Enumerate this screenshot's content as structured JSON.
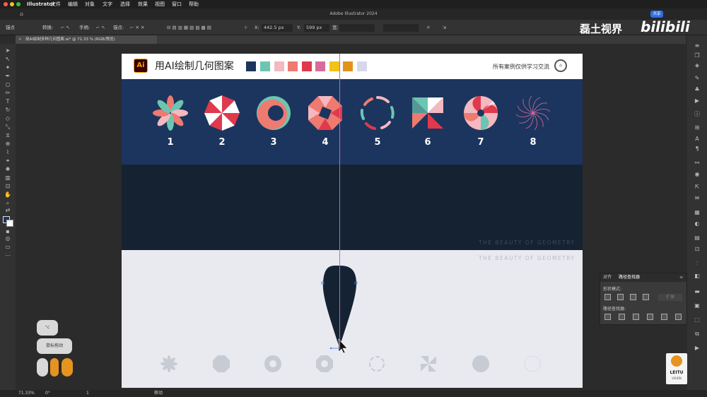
{
  "menubar": {
    "app": "Illustrator",
    "items": [
      "文件",
      "编辑",
      "对象",
      "文字",
      "选择",
      "效果",
      "视图",
      "窗口",
      "帮助"
    ]
  },
  "titlebar": {
    "title": "Adobe Illustrator 2024",
    "share": "共享"
  },
  "controlbar": {
    "anchor_label": "锚点",
    "convert_label": "转换:",
    "handle_label": "手柄:",
    "anchor2_label": "锚点:",
    "x_label": "X:",
    "x_value": "442.5 px",
    "y_label": "Y:",
    "y_value": "599 px",
    "w_label": "宽:"
  },
  "tab": {
    "label": "用AI绘制多种几何图案.ai* @ 71.33 % (RGB/预览)"
  },
  "artboard": {
    "title": "用AI绘制几何图案",
    "logo": "Ai",
    "note": "所有案例仅供学习交流",
    "swatches": [
      "#1c355e",
      "#6cc5b0",
      "#f4b8c0",
      "#ee7a70",
      "#e0394c",
      "#d96b9c",
      "#f0c21b",
      "#e3931a",
      "#d8d8ec"
    ],
    "numbers": [
      "1",
      "2",
      "3",
      "4",
      "5",
      "6",
      "7",
      "8"
    ],
    "caption_dark": "THE BEAUTY OF GEOMETRY",
    "caption_light": "THE BEAUTY OF GEOMETRY"
  },
  "colors": {
    "blue": "#1c355e",
    "dark": "#152232",
    "light": "#e8eaef",
    "teal": "#6cc5b0",
    "pink": "#f4b8c0",
    "coral": "#ee7a70",
    "red": "#e0394c",
    "guide": "#c45cf0"
  },
  "pathfinder": {
    "tab_align": "对齐",
    "tab_pathfinder": "路径查找器",
    "shape_modes": "形状模式:",
    "expand": "扩展",
    "pathfinders": "路径查找器:"
  },
  "statusbar": {
    "zoom": "71.33%",
    "angle": "0°",
    "artboard": "1",
    "tool": "移动"
  },
  "keyhints": {
    "key": "⌥",
    "action": "鼠标拖动"
  },
  "watermark": {
    "channel": "磊土视界",
    "brand": "bilibili",
    "leitu": "LEITU",
    "vision": "VISION"
  }
}
